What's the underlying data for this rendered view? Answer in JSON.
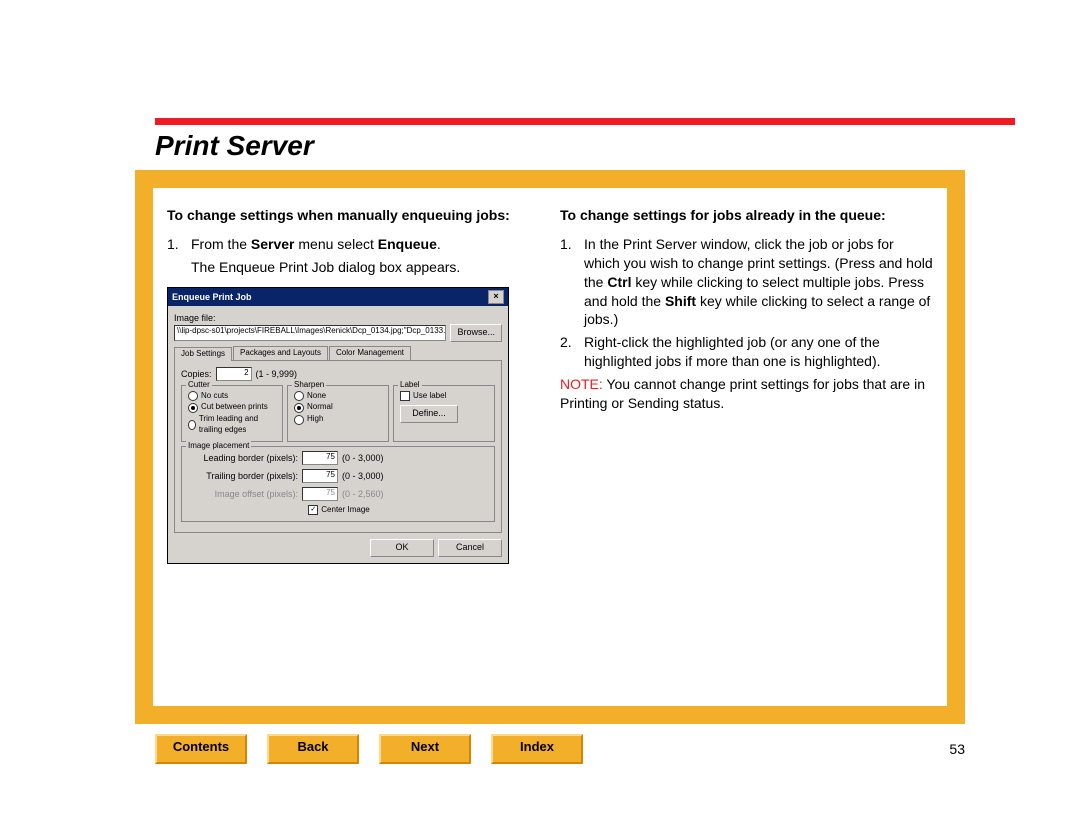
{
  "title": "Print Server",
  "page_number": "53",
  "left": {
    "heading": "To change settings when manually enqueuing jobs:",
    "step_num": "1.",
    "step_a": "From the ",
    "step_b_bold": "Server",
    "step_c": " menu select ",
    "step_d_bold": "Enqueue",
    "step_e": ".",
    "sub": "The Enqueue Print Job dialog box appears."
  },
  "right": {
    "heading": "To change settings for jobs already in the queue:",
    "s1_num": "1.",
    "s1_a": "In the Print Server window, click the job or jobs for which you wish to change print settings. (Press and hold the ",
    "s1_b_bold": "Ctrl",
    "s1_c": " key while clicking to select multiple jobs. Press and hold the ",
    "s1_d_bold": "Shift",
    "s1_e": " key while clicking to select a range of jobs.)",
    "s2_num": "2.",
    "s2": "Right-click the highlighted job (or any one of the highlighted jobs if more than one is highlighted).",
    "note_label": "NOTE:",
    "note_text": " You cannot change print settings for jobs that are in Printing or Sending status."
  },
  "dialog": {
    "title": "Enqueue Print Job",
    "image_file_label": "Image file:",
    "path": "\\\\lip-dpsc-s01\\projects\\FIREBALL\\Images\\Renick\\Dcp_0134.jpg;\"Dcp_0133.jpg",
    "browse": "Browse...",
    "tab1": "Job Settings",
    "tab2": "Packages and Layouts",
    "tab3": "Color Management",
    "copies_label": "Copies:",
    "copies_value": "2",
    "copies_range": "(1 - 9,999)",
    "cutter_label": "Cutter",
    "cutter_no": "No cuts",
    "cutter_between": "Cut between prints",
    "cutter_trim": "Trim leading and trailing edges",
    "sharpen_label": "Sharpen",
    "sharpen_none": "None",
    "sharpen_normal": "Normal",
    "sharpen_high": "High",
    "label_label": "Label",
    "use_label": "Use label",
    "define": "Define...",
    "placement_label": "Image placement",
    "leading": "Leading border (pixels):",
    "trailing": "Trailing border (pixels):",
    "offset": "Image offset (pixels):",
    "val75": "75",
    "range03000": "(0 - 3,000)",
    "range02560": "(0 - 2,560)",
    "center": "Center Image",
    "ok": "OK",
    "cancel": "Cancel"
  },
  "nav": {
    "contents": "Contents",
    "back": "Back",
    "next": "Next",
    "index": "Index"
  }
}
